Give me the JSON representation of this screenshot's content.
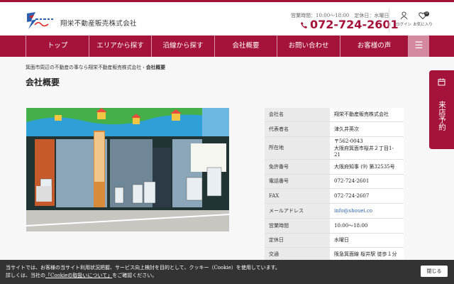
{
  "header": {
    "company_name": "翔栄不動産販売株式会社",
    "hours_text": "営業時間：10:00～18:00　定休日：水曜日",
    "phone": "072-724-2601",
    "login_label": "ログイン",
    "favorites_label": "お気に入り",
    "favorites_count": "0"
  },
  "nav": {
    "items": [
      {
        "label": "トップ"
      },
      {
        "label": "エリアから探す"
      },
      {
        "label": "沿線から探す"
      },
      {
        "label": "会社概要"
      },
      {
        "label": "お問い合わせ"
      },
      {
        "label": "お客様の声"
      }
    ],
    "menu_icon": "hamburger-icon"
  },
  "breadcrumb": {
    "home": "箕面市周辺の不動産の事なら翔栄不動産販売株式会社",
    "separator": "›",
    "current": "会社概要"
  },
  "page_title": "会社概要",
  "company_info": [
    {
      "key": "会社名",
      "value": "翔栄不動産販売株式会社"
    },
    {
      "key": "代表者名",
      "value": "津久井英次"
    },
    {
      "key": "所在地",
      "value": "〒562-0043",
      "value2": "大阪府箕面市桜井２丁目1-21"
    },
    {
      "key": "免許番号",
      "value": "大阪府知事 (9) 第32535号"
    },
    {
      "key": "電話番号",
      "value": "072-724-2601"
    },
    {
      "key": "FAX",
      "value": "072-724-2607"
    },
    {
      "key": "メールアドレス",
      "value": "info@shouei.co"
    },
    {
      "key": "営業時間",
      "value": "10:00～18:00"
    },
    {
      "key": "定休日",
      "value": "水曜日"
    },
    {
      "key": "交通",
      "value": "阪急箕面線 桜井駅 徒歩１分"
    }
  ],
  "side_tab": {
    "label": "来店予約"
  },
  "cookie": {
    "line1": "当サイトでは、お客様の当サイト利用状況把握、サービス向上検討を目的として、クッキー（Cookie）を使用しています。",
    "line2_pre": "詳しくは、当社の",
    "link": "「Cookieの取扱いについて」",
    "line2_post": "をご確認ください。",
    "close": "閉じる"
  },
  "colors": {
    "brand": "#a5123a",
    "menu": "#d4899e",
    "link": "#2a5fae"
  }
}
